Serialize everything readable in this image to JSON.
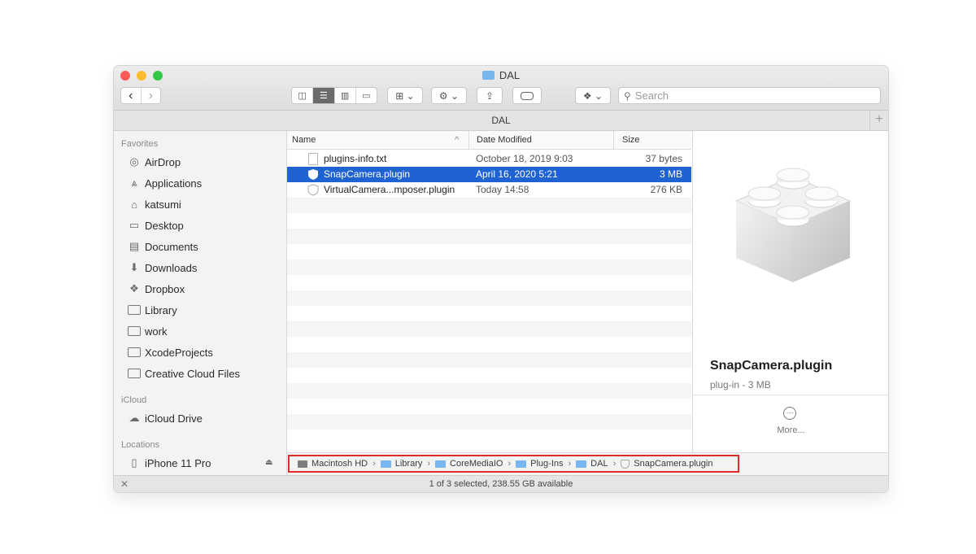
{
  "window": {
    "title": "DAL"
  },
  "toolbar": {
    "back": "‹",
    "forward": "›",
    "view_icons": [
      "◫",
      "☰",
      "▥",
      "▭"
    ],
    "search_placeholder": "Search"
  },
  "path_header": {
    "title": "DAL"
  },
  "sidebar": {
    "sections": [
      {
        "label": "Favorites",
        "items": [
          "AirDrop",
          "Applications",
          "katsumi",
          "Desktop",
          "Documents",
          "Downloads",
          "Dropbox",
          "Library",
          "work",
          "XcodeProjects",
          "Creative Cloud Files"
        ]
      },
      {
        "label": "iCloud",
        "items": [
          "iCloud Drive"
        ]
      },
      {
        "label": "Locations",
        "items": [
          "iPhone 11 Pro"
        ]
      }
    ]
  },
  "columns": {
    "name": "Name",
    "date": "Date Modified",
    "size": "Size"
  },
  "files": [
    {
      "name": "plugins-info.txt",
      "date": "October 18, 2019 9:03",
      "size": "37 bytes",
      "icon": "text-file-icon"
    },
    {
      "name": "SnapCamera.plugin",
      "date": "April 16, 2020 5:21",
      "size": "3 MB",
      "icon": "plugin-icon"
    },
    {
      "name": "VirtualCamera...mposer.plugin",
      "date": "Today 14:58",
      "size": "276 KB",
      "icon": "plugin-icon"
    }
  ],
  "preview": {
    "name": "SnapCamera.plugin",
    "info": "plug-in - 3 MB",
    "more": "More..."
  },
  "path_bar": [
    "Macintosh HD",
    "Library",
    "CoreMediaIO",
    "Plug-Ins",
    "DAL",
    "SnapCamera.plugin"
  ],
  "status": "1 of 3 selected, 238.55 GB available",
  "colors": {
    "selection": "#1f63d3",
    "highlight_box": "#df2b2b",
    "folder": "#78b6ee"
  }
}
